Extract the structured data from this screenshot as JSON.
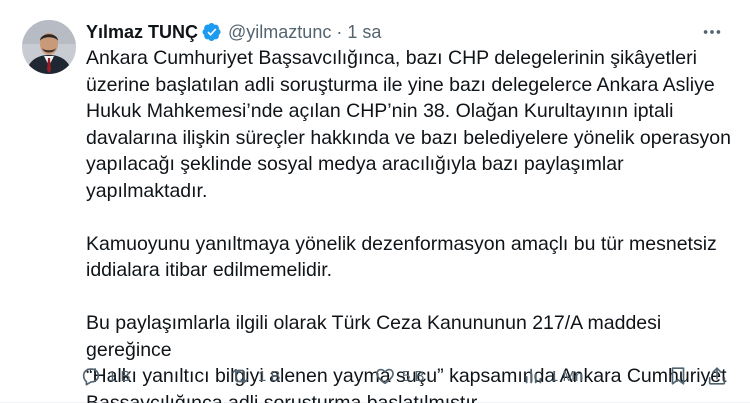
{
  "tweet": {
    "author_name": "Yılmaz TUNÇ",
    "handle": "@yilmaztunc",
    "separator": "·",
    "time": "1 sa",
    "paragraphs": [
      "Ankara Cumhuriyet Başsavcılığınca, bazı CHP delegelerinin şikâyetleri\nüzerine başlatılan adli soruşturma ile yine bazı delegelerce Ankara Asliye\nHukuk Mahkemesi’nde açılan CHP’nin 38. Olağan Kurultayının iptali\ndavalarına ilişkin süreçler hakkında ve bazı belediyelere yönelik operasyon\nyapılacağı şeklinde sosyal medya aracılığıyla bazı paylaşımlar yapılmaktadır.",
      "Kamuoyunu yanıltmaya yönelik dezenformasyon amaçlı bu tür mesnetsiz\niddialara itibar edilmemelidir.",
      "Bu paylaşımlarla ilgili olarak Türk Ceza Kanununun 217/A maddesi gereğince\n“Halkı yanıltıcı bilgiyi alenen yayma suçu” kapsamında Ankara Cumhuriyet\nBaşsavcılığınca adli soruşturma başlatılmıştır."
    ],
    "actions": {
      "reply_count": "1 B",
      "repost_count": "1 B",
      "like_count": "5 B",
      "view_count": "1 Mn"
    }
  },
  "icons": [
    "avatar",
    "verified-badge-icon",
    "more-icon",
    "reply-icon",
    "repost-icon",
    "like-icon",
    "views-icon",
    "bookmark-icon",
    "share-icon"
  ],
  "colors": {
    "text": "#0f1419",
    "muted": "#536471",
    "verified": "#1d9bf0"
  }
}
